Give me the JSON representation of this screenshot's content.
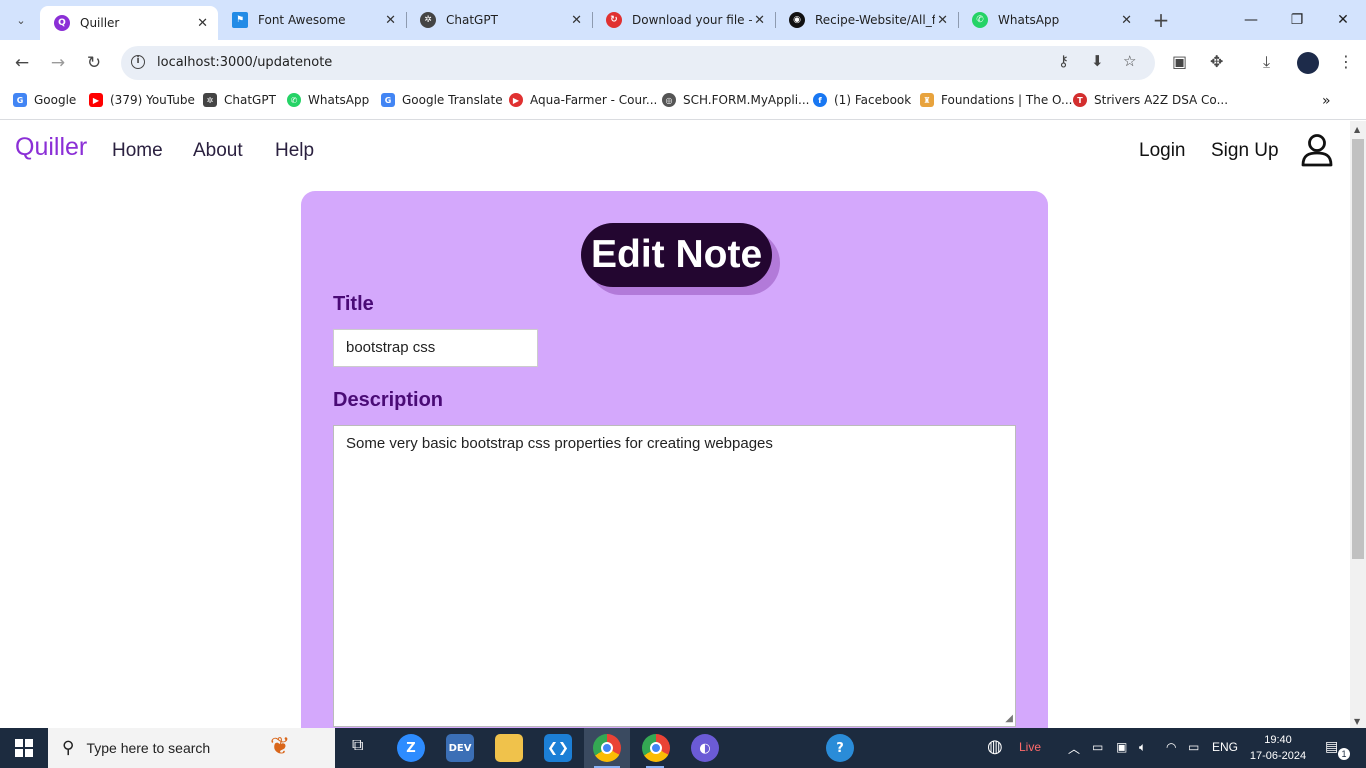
{
  "browser": {
    "tabs": [
      {
        "label": "Quiller",
        "icon": "quiller-icon",
        "color": "#8b2fd6",
        "glyph": "Q"
      },
      {
        "label": "Font Awesome",
        "icon": "flag-icon",
        "color": "#228be6",
        "glyph": "⚑"
      },
      {
        "label": "ChatGPT",
        "icon": "chatgpt-icon",
        "color": "#444444",
        "glyph": "✲"
      },
      {
        "label": "Download your file –",
        "icon": "download-site-icon",
        "color": "#e03131",
        "glyph": "↻"
      },
      {
        "label": "Recipe-Website/All_f",
        "icon": "github-icon",
        "color": "#111111",
        "glyph": "◉"
      },
      {
        "label": "WhatsApp",
        "icon": "whatsapp-icon",
        "color": "#25d366",
        "glyph": "✆"
      }
    ],
    "url": "localhost:3000/updatenote",
    "bookmarks": [
      {
        "label": "Google",
        "color": "#4285f4",
        "glyph": "G"
      },
      {
        "label": "(379) YouTube",
        "color": "#ff0000",
        "glyph": "▶"
      },
      {
        "label": "ChatGPT",
        "color": "#444444",
        "glyph": "✲"
      },
      {
        "label": "WhatsApp",
        "color": "#25d366",
        "glyph": "✆"
      },
      {
        "label": "Google Translate",
        "color": "#4285f4",
        "glyph": "G"
      },
      {
        "label": "Aqua-Farmer - Cour...",
        "color": "#e03131",
        "glyph": "▶"
      },
      {
        "label": "SCH.FORM.MyAppli...",
        "color": "#555555",
        "glyph": "◎"
      },
      {
        "label": "(1) Facebook",
        "color": "#1877f2",
        "glyph": "f"
      },
      {
        "label": "Foundations | The O...",
        "color": "#e8a33d",
        "glyph": "♜"
      },
      {
        "label": "Strivers A2Z DSA Co...",
        "color": "#d32f2f",
        "glyph": "T"
      }
    ]
  },
  "app": {
    "brand": "Quiller",
    "nav": [
      "Home",
      "About",
      "Help"
    ],
    "login": "Login",
    "signup": "Sign Up"
  },
  "form": {
    "heading": "Edit Note",
    "title_label": "Title",
    "title_value": "bootstrap css",
    "description_label": "Description",
    "description_value": "Some very basic bootstrap css properties for creating webpages"
  },
  "taskbar": {
    "search_placeholder": "Type here to search",
    "weather_label": "Live",
    "language": "ENG",
    "time": "19:40",
    "date": "17-06-2024",
    "notification_count": "1"
  },
  "colors": {
    "brand": "#8b2fd6",
    "card_bg": "#d4a8fc",
    "heading_bg": "#230630",
    "label": "#4a0b76"
  }
}
